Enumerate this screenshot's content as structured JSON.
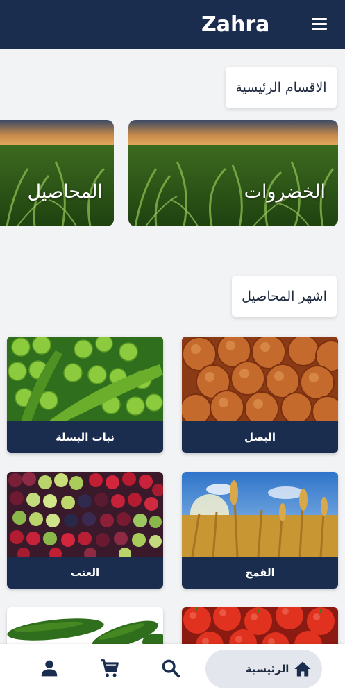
{
  "header": {
    "logo": "Zahra",
    "menu_icon": "menu-icon"
  },
  "sections": {
    "main_categories": "الاقسام الرئيسية",
    "top_crops": "اشهر المحاصيل"
  },
  "categories": [
    {
      "label": "الخضروات"
    },
    {
      "label": "المحاصيل"
    }
  ],
  "crops": [
    {
      "label": "البصل",
      "image": "onions"
    },
    {
      "label": "نبات البسلة",
      "image": "peas"
    },
    {
      "label": "القمح",
      "image": "wheat"
    },
    {
      "label": "العنب",
      "image": "grapes"
    },
    {
      "label": "",
      "image": "tomatoes"
    },
    {
      "label": "",
      "image": "cucumbers"
    }
  ],
  "bottom_nav": {
    "home_label": "الرئيسية",
    "items": [
      "home-icon",
      "search-icon",
      "cart-icon",
      "profile-icon"
    ]
  },
  "colors": {
    "primary": "#1b2d4f",
    "background": "#f2f3f5",
    "pill": "#e3e6ec"
  }
}
